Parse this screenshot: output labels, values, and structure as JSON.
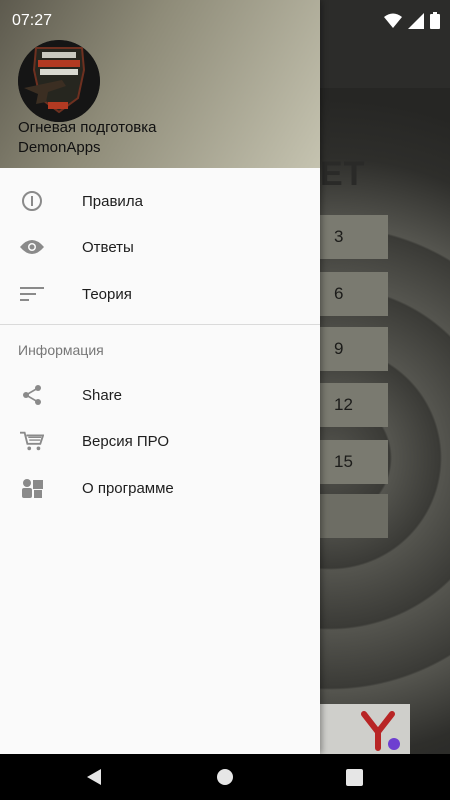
{
  "status_bar": {
    "time": "07:27"
  },
  "drawer": {
    "header": {
      "app_name": "Огневая подготовка",
      "developer": "DemonApps"
    },
    "main_items": [
      {
        "label": "Правила",
        "icon": "info-icon"
      },
      {
        "label": "Ответы",
        "icon": "eye-icon"
      },
      {
        "label": "Теория",
        "icon": "sort-lines-icon"
      }
    ],
    "section_title": "Информация",
    "info_items": [
      {
        "label": "Share",
        "icon": "share-icon"
      },
      {
        "label": "Версия ПРО",
        "icon": "cart-icon"
      },
      {
        "label": "О программе",
        "icon": "people-icon"
      }
    ]
  },
  "background": {
    "title_fragment": "ЕТ",
    "buttons": [
      "3",
      "6",
      "9",
      "12",
      "15"
    ]
  },
  "colors": {
    "drawer_bg": "#fafafa",
    "icon_gray": "#8a8a8a",
    "ad_red": "#b82525",
    "ad_purple": "#6e3fd0"
  }
}
